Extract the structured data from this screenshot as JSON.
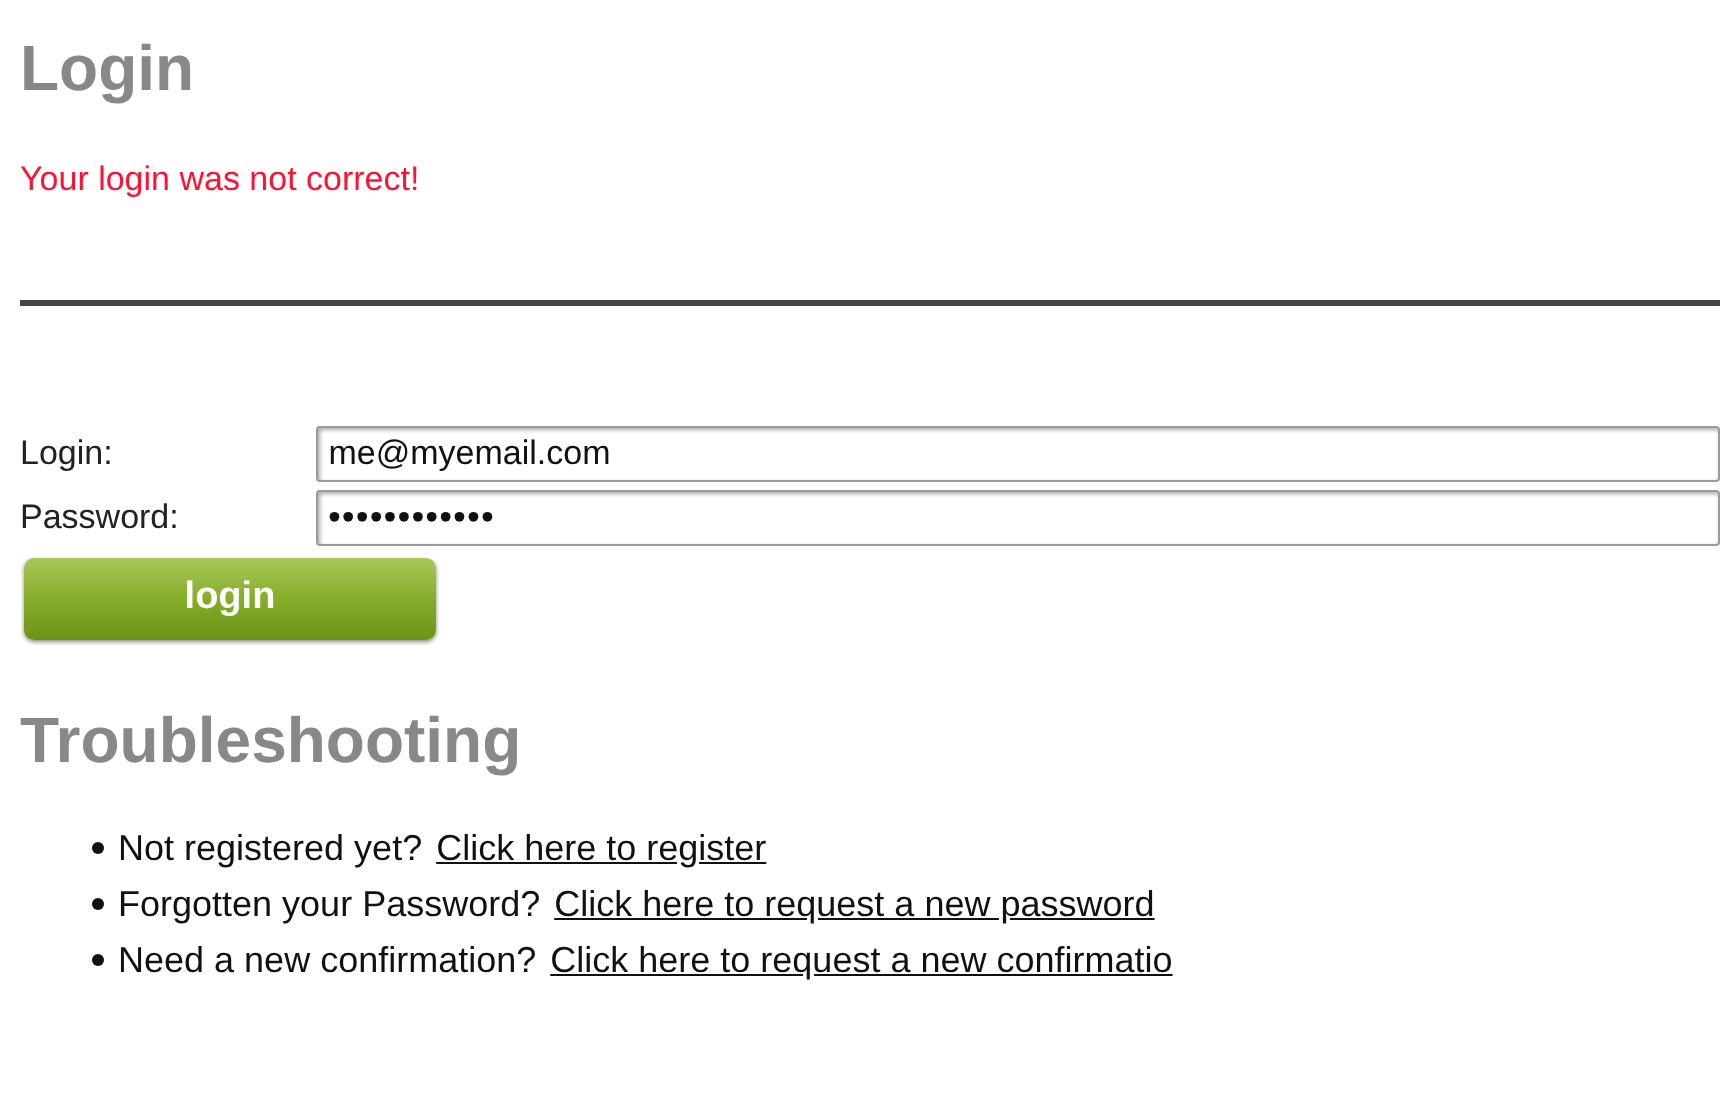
{
  "heading": "Login",
  "error": "Your login was not correct!",
  "form": {
    "fields": [
      {
        "label": "Login:",
        "value": "me@myemail.com",
        "kind": "text"
      },
      {
        "label": "Password:",
        "value": "••••••••••••",
        "kind": "password"
      }
    ],
    "button": "login"
  },
  "troubleshooting": {
    "title": "Troubleshooting",
    "items": [
      {
        "text": "Not registered yet?",
        "link": "Click here to register"
      },
      {
        "text": "Forgotten your Password?",
        "link": "Click here to request a new password"
      },
      {
        "text": "Need a new confirmation?",
        "link": "Click here to request a new confirmatio"
      }
    ]
  }
}
